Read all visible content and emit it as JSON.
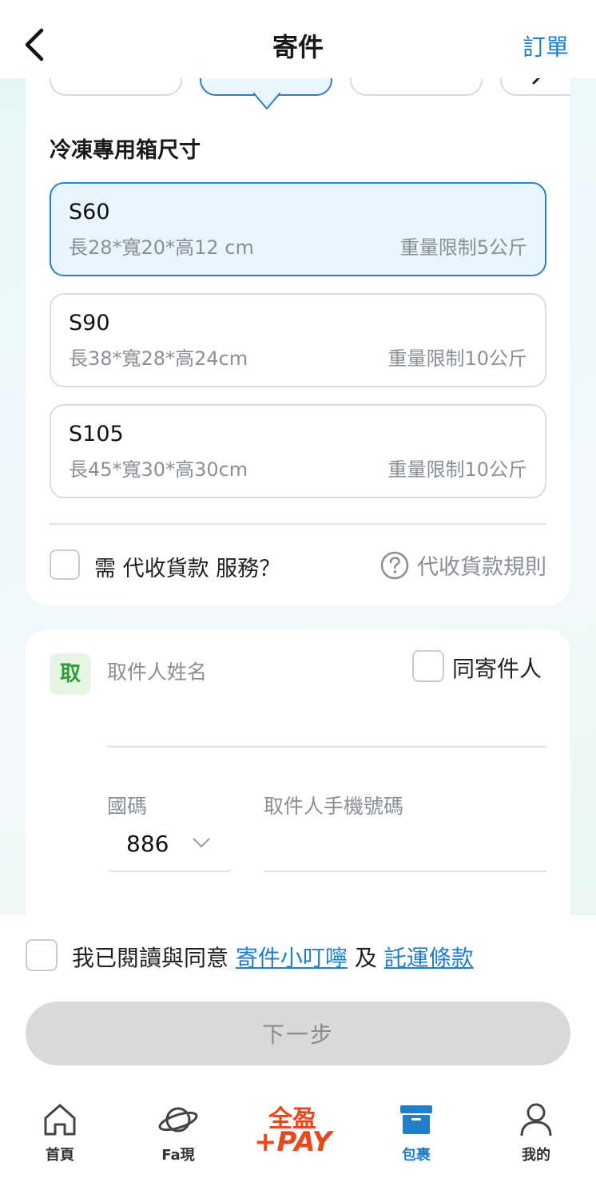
{
  "header": {
    "title": "寄件",
    "action": "訂單"
  },
  "box_section": {
    "title": "冷凍專用箱尺寸",
    "sizes": [
      {
        "name": "S60",
        "dimensions": "長28*寬20*高12 cm",
        "weight": "重量限制5公斤",
        "selected": true
      },
      {
        "name": "S90",
        "dimensions": "長38*寬28*高24cm",
        "weight": "重量限制10公斤",
        "selected": false
      },
      {
        "name": "S105",
        "dimensions": "長45*寬30*高30cm",
        "weight": "重量限制10公斤",
        "selected": false
      }
    ],
    "cod_label": "需 代收貨款 服務？",
    "cod_rule": "代收貨款規則"
  },
  "recipient": {
    "badge": "取",
    "name_label": "取件人姓名",
    "same_as_sender": "同寄件人",
    "country_code_label": "國碼",
    "country_code_value": "886",
    "phone_label": "取件人手機號碼"
  },
  "agreement": {
    "prefix": "我已閱讀與同意 ",
    "link1": "寄件小叮嚀",
    "middle": " 及 ",
    "link2": "託運條款"
  },
  "next_button": "下一步",
  "tabbar": {
    "items": [
      {
        "label": "首頁",
        "icon": "home-icon"
      },
      {
        "label": "Fa現",
        "icon": "planet-icon"
      },
      {
        "label": "全盈+PAY",
        "icon": "pay-logo"
      },
      {
        "label": "包裹",
        "icon": "package-box-icon",
        "active": true
      },
      {
        "label": "我的",
        "icon": "user-icon"
      }
    ],
    "pay_top": "全盈",
    "pay_bottom": "+PAY"
  },
  "colors": {
    "accent": "#1f7fc9",
    "selected_bg": "#e8f5fc",
    "badge_green": "#2f9e3a",
    "pay_orange": "#e8481b",
    "disabled_btn": "#d9d9d9"
  }
}
